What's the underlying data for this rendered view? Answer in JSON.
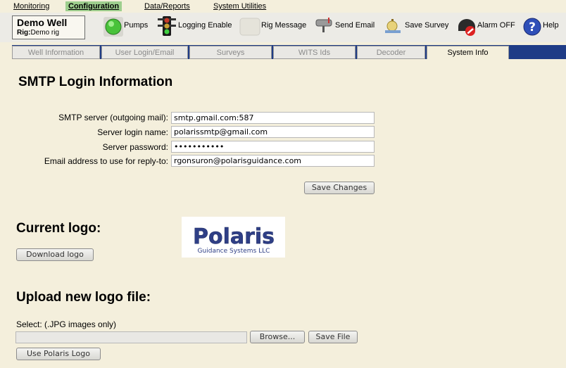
{
  "menu": {
    "monitoring": "Monitoring",
    "configuration": "Configuration",
    "data_reports": "Data/Reports",
    "system_utilities": "System Utilities"
  },
  "rig": {
    "well_name": "Demo Well",
    "rig_label": "Rig:",
    "rig_name": "Demo rig"
  },
  "toolbar": {
    "pumps": "Pumps",
    "logging_enable": "Logging Enable",
    "rig_message": "Rig Message",
    "send_email": "Send Email",
    "save_survey": "Save Survey",
    "alarm_off": "Alarm OFF",
    "help": "Help"
  },
  "tabs": [
    "Well Information",
    "User Login/Email",
    "Surveys",
    "WITS Ids",
    "Decoder",
    "System Info"
  ],
  "smtp": {
    "heading": "SMTP Login Information",
    "server_label": "SMTP server (outgoing mail):",
    "server_value": "smtp.gmail.com:587",
    "login_label": "Server login name:",
    "login_value": "polarissmtp@gmail.com",
    "password_label": "Server password:",
    "password_value": "•••••••••••",
    "reply_label": "Email address to use for reply-to:",
    "reply_value": "rgonsuron@polarisguidance.com",
    "save_button": "Save Changes"
  },
  "logo": {
    "heading": "Current logo:",
    "download_button": "Download logo",
    "brand_text": "Polaris",
    "brand_sub": "Guidance Systems LLC"
  },
  "upload": {
    "heading": "Upload new logo file:",
    "select_label": "Select: (.JPG images only)",
    "browse_button": "Browse...",
    "save_file_button": "Save File",
    "use_polaris_button": "Use Polaris Logo"
  },
  "colors": {
    "background": "#f4efdc",
    "tab_bar": "#1f3c86",
    "active_menu": "#9ecf8e"
  }
}
